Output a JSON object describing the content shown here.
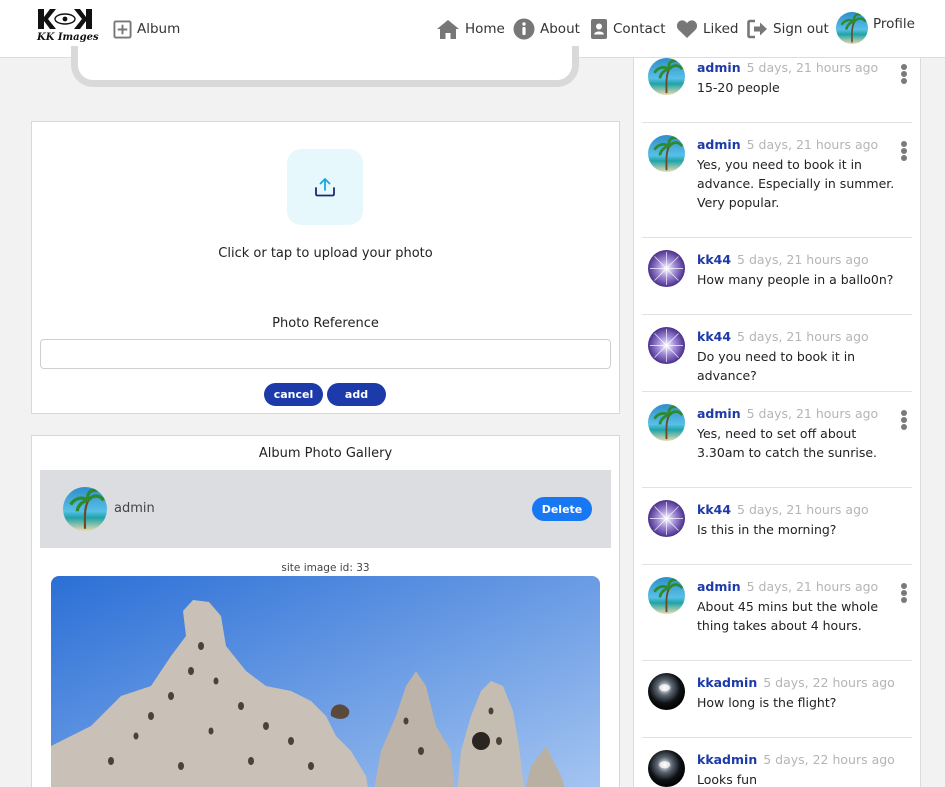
{
  "brand": {
    "logo_mark": "KK",
    "logo_text": "KK Images"
  },
  "nav": {
    "album": "Album",
    "home": "Home",
    "about": "About",
    "contact": "Contact",
    "liked": "Liked",
    "signout": "Sign out",
    "profile": "Profile"
  },
  "upload": {
    "prompt": "Click or tap to upload your photo",
    "reference_label": "Photo Reference",
    "reference_value": "",
    "cancel": "cancel",
    "add": "add"
  },
  "gallery": {
    "title": "Album Photo Gallery",
    "owner": "admin",
    "delete": "Delete",
    "site_image_id": "site image id: 33"
  },
  "comments": [
    {
      "user": "admin",
      "time": "5 days, 21 hours ago",
      "text": "15-20 people"
    },
    {
      "user": "admin",
      "time": "5 days, 21 hours ago",
      "text": "Yes, you need to book it in advance. Especially in summer. Very popular."
    },
    {
      "user": "kk44",
      "time": "5 days, 21 hours ago",
      "text": "How many people in a ballo0n?"
    },
    {
      "user": "kk44",
      "time": "5 days, 21 hours ago",
      "text": "Do you need to book it in advance?"
    },
    {
      "user": "admin",
      "time": "5 days, 21 hours ago",
      "text": "Yes, need to set off about 3.30am to catch the sunrise."
    },
    {
      "user": "kk44",
      "time": "5 days, 21 hours ago",
      "text": "Is this in the morning?"
    },
    {
      "user": "admin",
      "time": "5 days, 21 hours ago",
      "text": "About 45 mins but the whole thing takes about 4 hours."
    },
    {
      "user": "kkadmin",
      "time": "5 days, 22 hours ago",
      "text": "How long is the flight?"
    },
    {
      "user": "kkadmin",
      "time": "5 days, 22 hours ago",
      "text": "Looks fun"
    }
  ],
  "icons": {
    "album": "plus-square-icon",
    "home": "house-icon",
    "about": "info-circle-icon",
    "contact": "address-book-icon",
    "liked": "heart-icon",
    "signout": "sign-out-icon",
    "upload": "upload-tray-icon",
    "menu": "vertical-ellipsis-icon"
  },
  "colors": {
    "accent": "#1c3aa9",
    "delete": "#1877f2",
    "nav_icon": "#777777",
    "upload_bg": "#e7f8fd",
    "upload_icon": "#1aa7e0"
  }
}
